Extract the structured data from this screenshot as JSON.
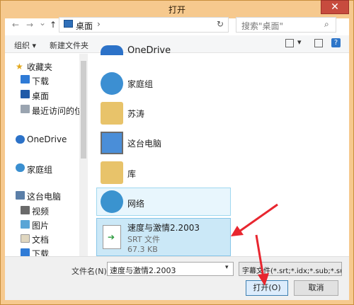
{
  "window": {
    "title": "打开",
    "close_label": "✕"
  },
  "address": {
    "back_icon": "←",
    "forward_icon": "→",
    "dropdown_icon": "⌄",
    "up_icon": "↑",
    "crumb": "桌面",
    "sep": "›",
    "refresh_icon": "↻",
    "search_placeholder": "搜索\"桌面\"",
    "search_icon": "⌕"
  },
  "toolbar": {
    "organize": "组织 ▾",
    "new_folder": "新建文件夹",
    "view_caret": "▾",
    "help": "?"
  },
  "nav": {
    "items": [
      {
        "label": "收藏夹",
        "icon": "star-icon"
      },
      {
        "label": "下载",
        "icon": "download-icon"
      },
      {
        "label": "桌面",
        "icon": "desktop-icon"
      },
      {
        "label": "最近访问的位",
        "icon": "recent-icon"
      },
      {
        "label": "OneDrive",
        "icon": "cloud-icon"
      },
      {
        "label": "家庭组",
        "icon": "homegroup-icon"
      },
      {
        "label": "这台电脑",
        "icon": "computer-icon"
      },
      {
        "label": "视频",
        "icon": "video-icon"
      },
      {
        "label": "图片",
        "icon": "picture-icon"
      },
      {
        "label": "文档",
        "icon": "document-icon"
      },
      {
        "label": "下载",
        "icon": "download-icon"
      }
    ]
  },
  "files": [
    {
      "name": "OneDrive",
      "icon": "cloud-icon"
    },
    {
      "name": "家庭组",
      "icon": "homegroup-icon"
    },
    {
      "name": "苏涛",
      "icon": "user-folder-icon"
    },
    {
      "name": "这台电脑",
      "icon": "computer-icon"
    },
    {
      "name": "库",
      "icon": "library-icon"
    },
    {
      "name": "网络",
      "icon": "network-icon"
    },
    {
      "name": "速度与激情2.2003",
      "type": "SRT 文件",
      "size": "67.3 KB",
      "icon": "srt-file-icon"
    }
  ],
  "bottom": {
    "filename_label": "文件名(N):",
    "filename_value": "速度与激情2.2003",
    "filetype_value": "字幕文件(*.srt;*.idx;*.sub;*.sup",
    "open_label": "打开(O)",
    "cancel_label": "取消"
  },
  "colors": {
    "frame": "#f6c98e",
    "selection": "#cbe8f7",
    "hover": "#e8f6fd",
    "arrow": "#e8262f",
    "accent": "#2f76c9"
  }
}
